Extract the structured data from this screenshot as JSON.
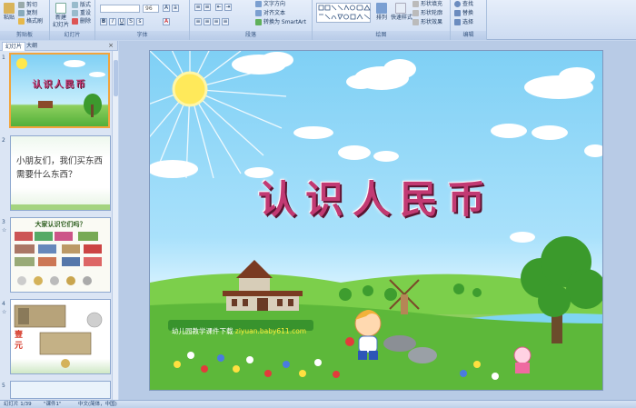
{
  "ribbon": {
    "clipboard": {
      "paste": "粘贴",
      "cut": "剪切",
      "copy": "复制",
      "format_painter": "格式刷",
      "label": "剪贴板"
    },
    "slides": {
      "new_slide": "新建\n幻灯片",
      "layout": "版式",
      "reset": "重设",
      "delete": "删除",
      "label": "幻灯片"
    },
    "font": {
      "font_name": "",
      "font_size": "96",
      "label": "字体"
    },
    "paragraph": {
      "text_direction": "文字方向",
      "align_text": "对齐文本",
      "smartart": "转换为 SmartArt",
      "label": "段落"
    },
    "drawing": {
      "arrange": "排列",
      "quick_styles": "快速样式",
      "shape_fill": "形状填充",
      "shape_outline": "形状轮廓",
      "shape_effects": "形状效果",
      "label": "绘图"
    },
    "editing": {
      "find": "查找",
      "replace": "替换",
      "select": "选择",
      "label": "编辑"
    }
  },
  "panel": {
    "tab_slides": "幻灯片",
    "tab_outline": "大纲",
    "close": "×",
    "thumbnails": [
      {
        "num": "1",
        "title": "认识人民币"
      },
      {
        "num": "2",
        "text": "小朋友们，我们买东西需要什么东西？"
      },
      {
        "num": "3",
        "title": "大家认识它们吗？"
      },
      {
        "num": "4",
        "text": "壹元"
      },
      {
        "num": "5"
      }
    ]
  },
  "slide": {
    "title": "认识人民币",
    "credit_prefix": "幼儿园教学课件下载",
    "credit_url": "ziyuan.baby611.com"
  },
  "status": {
    "slide_count": "幻灯片 1/39",
    "theme": "\"课件1\"",
    "language": "中文(简体，中国)"
  },
  "colors": {
    "ribbon_bg": "#dfe9f7",
    "title_color": "#c23a73",
    "thumb_selected": "#f2a43b"
  }
}
